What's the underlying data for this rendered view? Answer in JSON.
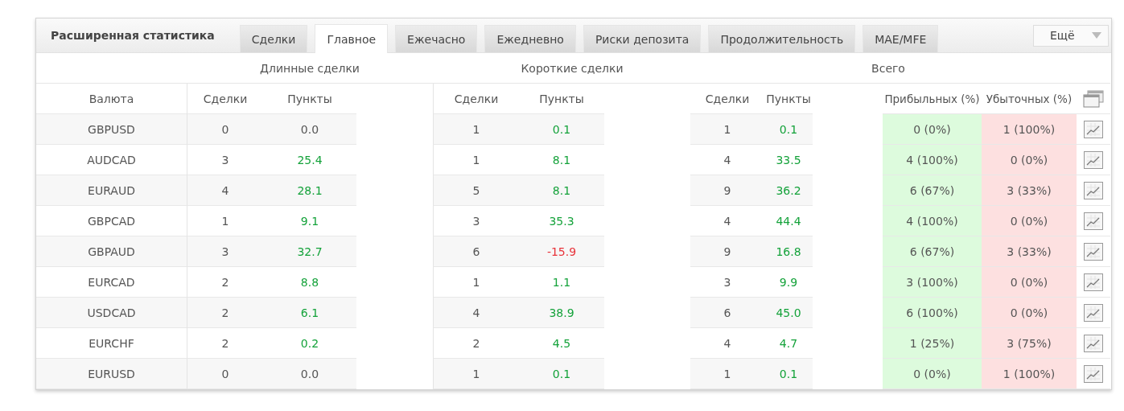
{
  "panel": {
    "title": "Расширенная статистика"
  },
  "tabs": [
    {
      "label": "Сделки",
      "selected": false
    },
    {
      "label": "Главное",
      "selected": true
    },
    {
      "label": "Ежечасно",
      "selected": false
    },
    {
      "label": "Ежедневно",
      "selected": false
    },
    {
      "label": "Риски депозита",
      "selected": false
    },
    {
      "label": "Продолжительность",
      "selected": false
    },
    {
      "label": "MAE/MFE",
      "selected": false
    }
  ],
  "more_dropdown": {
    "label": "Ещё"
  },
  "table": {
    "groups": [
      "Длинные сделки",
      "Короткие сделки",
      "Всего"
    ],
    "columns": {
      "currency": "Валюта",
      "long_trades": "Сделки",
      "long_points": "Пункты",
      "short_trades": "Сделки",
      "short_points": "Пункты",
      "total_trades": "Сделки",
      "total_points": "Пункты",
      "profitable": "Прибыльных (%)",
      "losing": "Убыточных (%)"
    },
    "rows": [
      {
        "currency": "GBPUSD",
        "long_trades": "0",
        "long_points": {
          "text": "0.0",
          "color": "#555555"
        },
        "short_trades": "1",
        "short_points": {
          "text": "0.1",
          "color": "#14a23a"
        },
        "total_trades": "1",
        "total_points": {
          "text": "0.1",
          "color": "#14a23a"
        },
        "profitable": "0 (0%)",
        "losing": "1 (100%)"
      },
      {
        "currency": "AUDCAD",
        "long_trades": "3",
        "long_points": {
          "text": "25.4",
          "color": "#14a23a"
        },
        "short_trades": "1",
        "short_points": {
          "text": "8.1",
          "color": "#14a23a"
        },
        "total_trades": "4",
        "total_points": {
          "text": "33.5",
          "color": "#14a23a"
        },
        "profitable": "4 (100%)",
        "losing": "0 (0%)"
      },
      {
        "currency": "EURAUD",
        "long_trades": "4",
        "long_points": {
          "text": "28.1",
          "color": "#14a23a"
        },
        "short_trades": "5",
        "short_points": {
          "text": "8.1",
          "color": "#14a23a"
        },
        "total_trades": "9",
        "total_points": {
          "text": "36.2",
          "color": "#14a23a"
        },
        "profitable": "6 (67%)",
        "losing": "3 (33%)"
      },
      {
        "currency": "GBPCAD",
        "long_trades": "1",
        "long_points": {
          "text": "9.1",
          "color": "#14a23a"
        },
        "short_trades": "3",
        "short_points": {
          "text": "35.3",
          "color": "#14a23a"
        },
        "total_trades": "4",
        "total_points": {
          "text": "44.4",
          "color": "#14a23a"
        },
        "profitable": "4 (100%)",
        "losing": "0 (0%)"
      },
      {
        "currency": "GBPAUD",
        "long_trades": "3",
        "long_points": {
          "text": "32.7",
          "color": "#14a23a"
        },
        "short_trades": "6",
        "short_points": {
          "text": "-15.9",
          "color": "#e8333a"
        },
        "total_trades": "9",
        "total_points": {
          "text": "16.8",
          "color": "#14a23a"
        },
        "profitable": "6 (67%)",
        "losing": "3 (33%)"
      },
      {
        "currency": "EURCAD",
        "long_trades": "2",
        "long_points": {
          "text": "8.8",
          "color": "#14a23a"
        },
        "short_trades": "1",
        "short_points": {
          "text": "1.1",
          "color": "#14a23a"
        },
        "total_trades": "3",
        "total_points": {
          "text": "9.9",
          "color": "#14a23a"
        },
        "profitable": "3 (100%)",
        "losing": "0 (0%)"
      },
      {
        "currency": "USDCAD",
        "long_trades": "2",
        "long_points": {
          "text": "6.1",
          "color": "#14a23a"
        },
        "short_trades": "4",
        "short_points": {
          "text": "38.9",
          "color": "#14a23a"
        },
        "total_trades": "6",
        "total_points": {
          "text": "45.0",
          "color": "#14a23a"
        },
        "profitable": "6 (100%)",
        "losing": "0 (0%)"
      },
      {
        "currency": "EURCHF",
        "long_trades": "2",
        "long_points": {
          "text": "0.2",
          "color": "#14a23a"
        },
        "short_trades": "2",
        "short_points": {
          "text": "4.5",
          "color": "#14a23a"
        },
        "total_trades": "4",
        "total_points": {
          "text": "4.7",
          "color": "#14a23a"
        },
        "profitable": "1 (25%)",
        "losing": "3 (75%)"
      },
      {
        "currency": "EURUSD",
        "long_trades": "0",
        "long_points": {
          "text": "0.0",
          "color": "#555555"
        },
        "short_trades": "1",
        "short_points": {
          "text": "0.1",
          "color": "#14a23a"
        },
        "total_trades": "1",
        "total_points": {
          "text": "0.1",
          "color": "#14a23a"
        },
        "profitable": "0 (0%)",
        "losing": "1 (100%)"
      }
    ]
  }
}
